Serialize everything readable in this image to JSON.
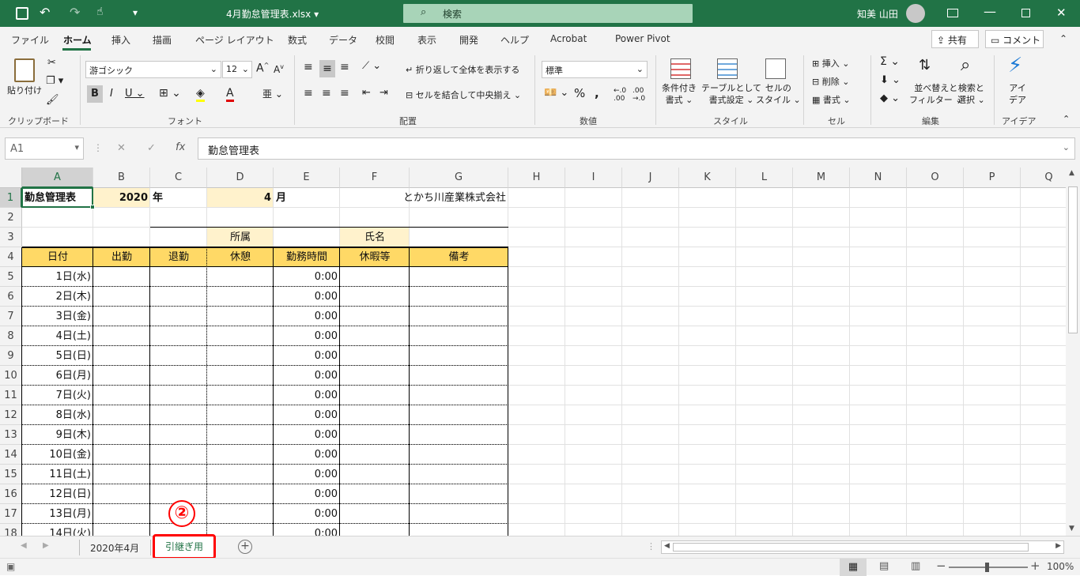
{
  "title_bar": {
    "filename": "4月勤怠管理表.xlsx",
    "search_placeholder": "検索",
    "user_name": "知美 山田"
  },
  "menu": {
    "tabs": [
      "ファイル",
      "ホーム",
      "挿入",
      "描画",
      "ページ レイアウト",
      "数式",
      "データ",
      "校閲",
      "表示",
      "開発",
      "ヘルプ",
      "Acrobat",
      "Power Pivot"
    ],
    "active": "ホーム",
    "share": "共有",
    "comment": "コメント"
  },
  "ribbon": {
    "clipboard": {
      "paste": "貼り付け",
      "label": "クリップボード"
    },
    "font": {
      "name": "游ゴシック",
      "size": "12",
      "label": "フォント"
    },
    "alignment": {
      "wrap": "折り返して全体を表示する",
      "merge": "セルを結合して中央揃え",
      "label": "配置"
    },
    "number": {
      "format": "標準",
      "label": "数値"
    },
    "styles": {
      "conditional": [
        "条件付き",
        "書式"
      ],
      "table": [
        "テーブルとして",
        "書式設定"
      ],
      "cell": [
        "セルの",
        "スタイル"
      ],
      "label": "スタイル"
    },
    "cells": {
      "insert": "挿入",
      "delete": "削除",
      "format": "書式",
      "label": "セル"
    },
    "editing": {
      "sort": [
        "並べ替えと",
        "フィルター"
      ],
      "find": [
        "検索と",
        "選択"
      ],
      "label": "編集"
    },
    "ideas": {
      "button": [
        "アイ",
        "デア"
      ],
      "label": "アイデア"
    }
  },
  "formula_bar": {
    "cell_ref": "A1",
    "content": "勤怠管理表"
  },
  "sheet": {
    "columns": [
      "A",
      "B",
      "C",
      "D",
      "E",
      "F",
      "G",
      "H",
      "I",
      "J",
      "K",
      "L",
      "M",
      "N",
      "O",
      "P",
      "Q"
    ],
    "rows": [
      "1",
      "2",
      "3",
      "4",
      "5",
      "6",
      "7",
      "8",
      "9",
      "10",
      "11",
      "12",
      "13",
      "14",
      "15",
      "16",
      "17",
      "18"
    ],
    "r1": {
      "title": "勤怠管理表",
      "year": "2020",
      "year_unit": "年",
      "month": "4",
      "month_unit": "月",
      "company": "とかち川産業株式会社"
    },
    "r3": {
      "dept": "所属",
      "name": "氏名"
    },
    "headers": [
      "日付",
      "出勤",
      "退勤",
      "休憩",
      "勤務時間",
      "休暇等",
      "備考"
    ],
    "days": [
      "1日(水)",
      "2日(木)",
      "3日(金)",
      "4日(土)",
      "5日(日)",
      "6日(月)",
      "7日(火)",
      "8日(水)",
      "9日(木)",
      "10日(金)",
      "11日(土)",
      "12日(日)",
      "13日(月)",
      "14日(火)"
    ],
    "work_time": "0:00"
  },
  "tabs": {
    "sheets": [
      "2020年4月",
      "引継ぎ用"
    ],
    "active": "引継ぎ用",
    "marker": "②"
  },
  "status": {
    "zoom": "100%"
  },
  "colors": {
    "excel_green": "#217346",
    "highlight": "#ffd966",
    "light_yellow": "#fff2cc",
    "callout_red": "#ff0000"
  }
}
